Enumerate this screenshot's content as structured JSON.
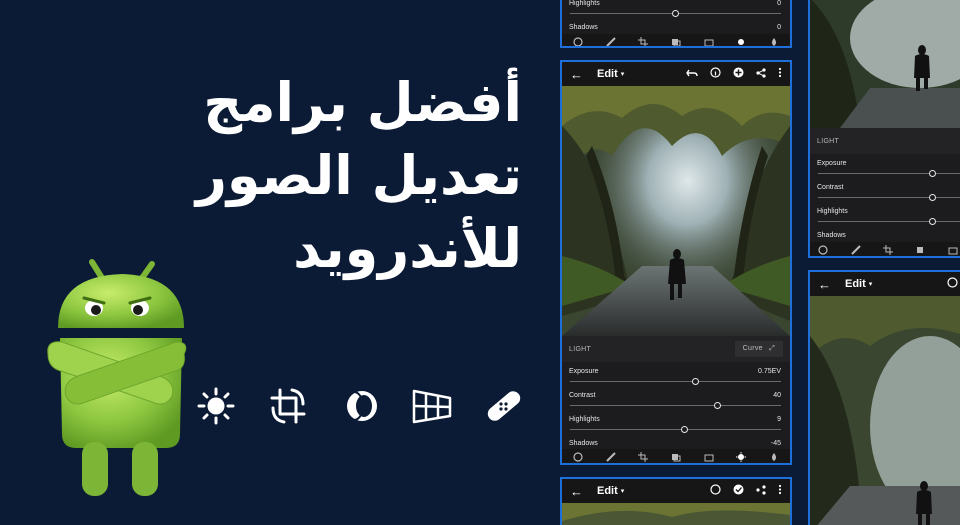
{
  "banner": {
    "title_lines": [
      "أفضل برامج",
      "تعديل الصور",
      "للأندرويد"
    ]
  },
  "tool_icons": [
    "bandage-icon",
    "perspective-grid-icon",
    "lens-icon",
    "crop-rotate-icon",
    "brightness-icon"
  ],
  "colors": {
    "background": "#0b1a35",
    "panel_border": "#1e6fd9",
    "android_green": "#8cc63f"
  },
  "top_panel": {
    "sliders": [
      {
        "label": "Highlights",
        "value": "0",
        "position": 0.5
      },
      {
        "label": "Shadows",
        "value": "0",
        "position": 0.5
      }
    ]
  },
  "main_panel": {
    "title": "Edit",
    "back_glyph": "←",
    "caret_glyph": "▾",
    "section_label": "LIGHT",
    "curve_label": "Curve",
    "curve_glyph": "⤢",
    "sliders": [
      {
        "label": "Exposure",
        "value": "0.75EV",
        "position": 0.595
      },
      {
        "label": "Contrast",
        "value": "40",
        "position": 0.7
      },
      {
        "label": "Highlights",
        "value": "9",
        "position": 0.545
      },
      {
        "label": "Shadows",
        "value": "-45",
        "position": 0.275
      }
    ]
  },
  "bottom_panel": {
    "title": "Edit",
    "back_glyph": "←",
    "caret_glyph": "▾"
  },
  "right_panel": {
    "section_label": "LIGHT",
    "sliders": [
      {
        "label": "Exposure",
        "position": 0.75
      },
      {
        "label": "Contrast",
        "position": 0.75
      },
      {
        "label": "Highlights",
        "position": 0.75
      },
      {
        "label": "Shadows"
      }
    ]
  },
  "right_bottom_panel": {
    "title": "Edit",
    "back_glyph": "←",
    "caret_glyph": "▾"
  }
}
